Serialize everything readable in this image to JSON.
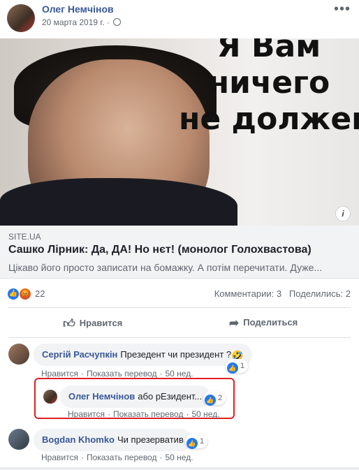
{
  "post": {
    "author": "Олег Немчінов",
    "date": "20 марта 2019 г.",
    "more_label": "•••",
    "image_text": [
      "Я Вам",
      "ничего",
      "не должен!"
    ],
    "info_label": "i",
    "link_domain": "SITE.UA",
    "link_title": "Сашко Лірник: Да, ДА! Но нєт! (монолог Голохвастова)",
    "link_desc": "Цікаво його просто записати на бомажку. А потім перечитати. Дуже..."
  },
  "stats": {
    "reactions_count": "22",
    "comments": "Комментарии: 3",
    "shares": "Поделились: 2",
    "reactions": [
      "like",
      "angry"
    ]
  },
  "actions": {
    "like": "Нравится",
    "share": "Поделиться"
  },
  "comments": [
    {
      "author": "Сергій Расчупкін",
      "text": "Презедент чи президент ?",
      "emoji": "🤣",
      "like": "Нравится",
      "translate": "Показать перевод",
      "age": "50 нед.",
      "reactions": "1"
    },
    {
      "author": "Олег Немчінов",
      "text": "або рЕзидент...",
      "like": "Нравится",
      "translate": "Показать перевод",
      "age": "50 нед.",
      "reactions": "2"
    },
    {
      "author": "Bogdan Khomko",
      "text": "Чи презерватив",
      "like": "Нравится",
      "translate": "Показать перевод",
      "age": "50 нед.",
      "reactions": "1"
    }
  ],
  "colors": {
    "link_blue": "#385898",
    "like_blue": "#2078f4",
    "highlight_red": "#e02020"
  }
}
